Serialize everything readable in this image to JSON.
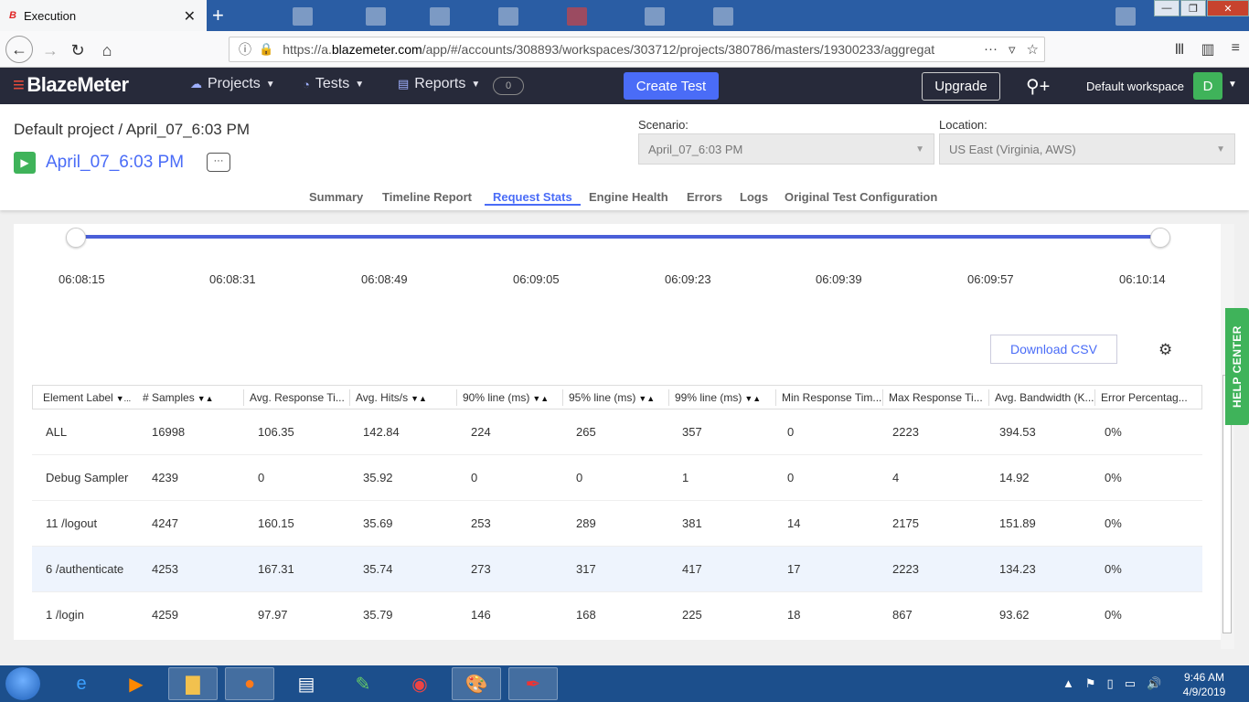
{
  "browser": {
    "tab_title": "Execution",
    "tab_favicon": "B",
    "url_prefix": "https://a.",
    "url_domain": "blazemeter.com",
    "url_rest": "/app/#/accounts/308893/workspaces/303712/projects/380786/masters/19300233/aggregat"
  },
  "header": {
    "logo": "BlazeMeter",
    "menus": [
      "Projects",
      "Tests",
      "Reports"
    ],
    "counter": "0",
    "create_test": "Create Test",
    "upgrade": "Upgrade",
    "workspace": "Default workspace",
    "avatar": "D"
  },
  "page": {
    "breadcrumb": "Default project / April_07_6:03 PM",
    "test_name": "April_07_6:03 PM",
    "more": "···",
    "scenario_label": "Scenario:",
    "scenario_value": "April_07_6:03 PM",
    "location_label": "Location:",
    "location_value": "US East (Virginia, AWS)",
    "tabs": [
      "Summary",
      "Timeline Report",
      "Request Stats",
      "Engine Health",
      "Errors",
      "Logs",
      "Original Test Configuration"
    ],
    "active_tab": "Request Stats"
  },
  "timeline": {
    "ticks": [
      "06:08:15",
      "06:08:31",
      "06:08:49",
      "06:09:05",
      "06:09:23",
      "06:09:39",
      "06:09:57",
      "06:10:14"
    ]
  },
  "actions": {
    "download_csv": "Download CSV"
  },
  "table": {
    "columns": [
      "Element Label",
      "# Samples",
      "Avg. Response Ti...",
      "Avg. Hits/s",
      "90% line (ms)",
      "95% line (ms)",
      "99% line (ms)",
      "Min Response Tim...",
      "Max Response Ti...",
      "Avg. Bandwidth (K...",
      "Error Percentag..."
    ],
    "rows": [
      [
        "ALL",
        "16998",
        "106.35",
        "142.84",
        "224",
        "265",
        "357",
        "0",
        "2223",
        "394.53",
        "0%"
      ],
      [
        "Debug Sampler",
        "4239",
        "0",
        "35.92",
        "0",
        "0",
        "1",
        "0",
        "4",
        "14.92",
        "0%"
      ],
      [
        "11 /logout",
        "4247",
        "160.15",
        "35.69",
        "253",
        "289",
        "381",
        "14",
        "2175",
        "151.89",
        "0%"
      ],
      [
        "6 /authenticate",
        "4253",
        "167.31",
        "35.74",
        "273",
        "317",
        "417",
        "17",
        "2223",
        "134.23",
        "0%"
      ],
      [
        "1 /login",
        "4259",
        "97.97",
        "35.79",
        "146",
        "168",
        "225",
        "18",
        "867",
        "93.62",
        "0%"
      ]
    ]
  },
  "help_center": "HELP CENTER",
  "taskbar": {
    "time": "9:46 AM",
    "date": "4/9/2019"
  }
}
